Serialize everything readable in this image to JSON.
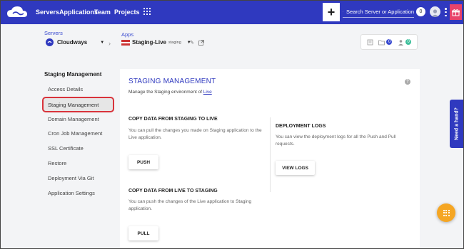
{
  "topbar": {
    "nav": [
      "Servers",
      "Applications",
      "Team",
      "Projects"
    ],
    "plus": "+",
    "search_placeholder": "Search Server or Application",
    "notification_count": "0",
    "colors": {
      "bar": "#2f39bf",
      "gift": "#e8436b"
    }
  },
  "context": {
    "servers_label": "Servers",
    "server_name": "Cloudways",
    "apps_label": "Apps",
    "app_name": "Staging-Live",
    "app_tag": "staging",
    "stats": [
      {
        "icon": "list-icon",
        "count": ""
      },
      {
        "icon": "folder-icon",
        "count": "0"
      },
      {
        "icon": "users-icon",
        "count": "0"
      }
    ]
  },
  "sidebar": {
    "title": "Staging Management",
    "items": [
      "Access Details",
      "Staging Management",
      "Domain Management",
      "Cron Job Management",
      "SSL Certificate",
      "Restore",
      "Deployment Via Git",
      "Application Settings"
    ]
  },
  "main": {
    "title": "STAGING MANAGEMENT",
    "desc_prefix": "Manage the Staging environment of ",
    "desc_link": "Live",
    "help": "?",
    "copy_to_live": {
      "heading": "COPY DATA FROM STAGING TO LIVE",
      "text": "You can pull the changes you made on Staging application to the Live application.",
      "button": "PUSH"
    },
    "copy_to_staging": {
      "heading": "COPY DATA FROM LIVE TO STAGING",
      "text": "You can push the changes of the Live application to Staging application.",
      "button": "PULL"
    },
    "logs": {
      "heading": "DEPLOYMENT LOGS",
      "text": "You can view the deployment logs for all the Push and Pull requests.",
      "button": "VIEW LOGS"
    }
  },
  "floaters": {
    "need_hand": "Need a hand?"
  }
}
